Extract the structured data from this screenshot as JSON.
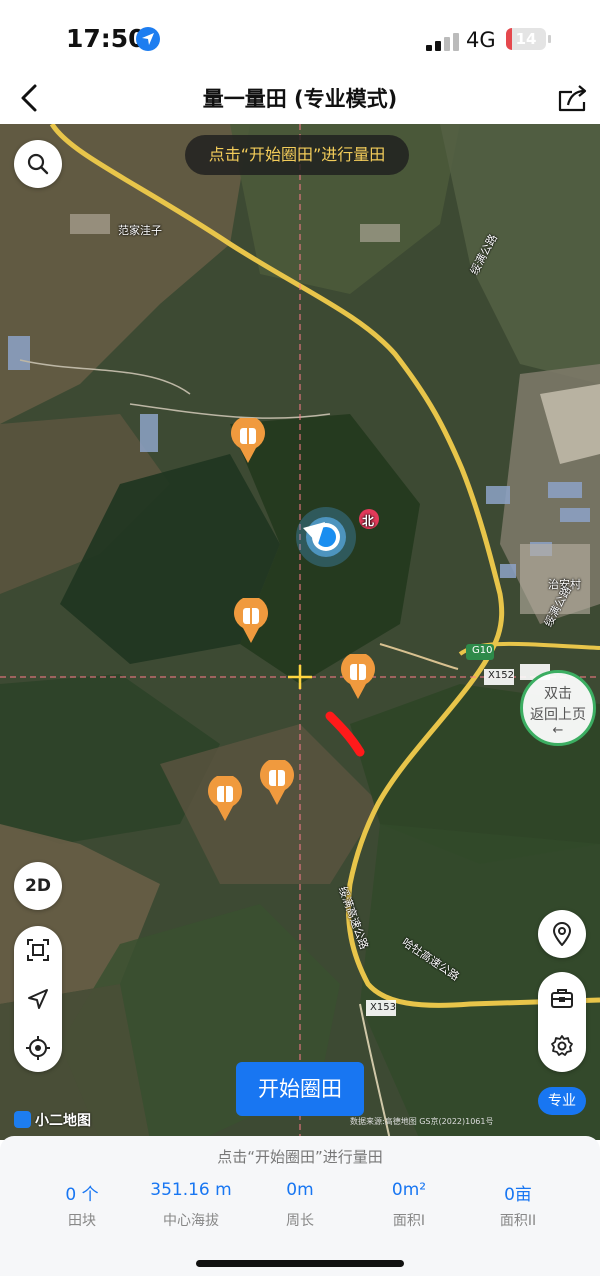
{
  "status_bar": {
    "time": "17:50",
    "network": "4G",
    "battery": "14",
    "battery_level": 0.14,
    "location_icon": "location-arrow-icon",
    "signal_icon": "cellular-signal-icon"
  },
  "nav": {
    "back_icon": "chevron-left-icon",
    "title": "量一量田 (专业模式)",
    "share_icon": "share-icon"
  },
  "map": {
    "hint": "点击“开始圈田”进行量田",
    "labels": {
      "village_fanjia": "范家洼子",
      "road_suiman_1": "绥满公路",
      "road_suiman_2": "绥满公路",
      "compass_north": "北",
      "village_zhian": "治安村",
      "expressway_g10": "G10",
      "road_x152": "X152",
      "road_x153": "X153",
      "expressway_suiman": "绥满高速公路",
      "expressway_hama": "哈牡高速公路"
    },
    "back_page": {
      "line1": "双击",
      "line2": "返回上页",
      "arrow": "←"
    },
    "start_button": "开始圈田",
    "logo": "小二地图",
    "copyright": "数据来源:高德地图 GS京(2022)1061号",
    "pro_badge": "专业",
    "mode_2d": "2D",
    "left_tools": [
      "capture-frame-icon",
      "navigation-arrow-icon",
      "locate-crosshair-icon"
    ],
    "right_tools": [
      "toolbox-icon",
      "settings-gear-icon"
    ],
    "search_icon": "search-icon",
    "location_pin_icon": "location-pin-icon",
    "field_pin_icon": "field-marker-icon",
    "colors": {
      "accent": "#1876f2",
      "road": "#e8c54a",
      "pin": "#f09a3e",
      "hint_text": "#f2cc5a",
      "back_page_border": "#3cae62",
      "drawn_stroke": "#ff1a1a"
    }
  },
  "panel": {
    "hint": "点击“开始圈田”进行量田",
    "stats": [
      {
        "value": "0 个",
        "label": "田块"
      },
      {
        "value": "351.16 m",
        "label": "中心海拔"
      },
      {
        "value": "0m",
        "label": "周长"
      },
      {
        "value": "0m²",
        "label": "面积I"
      },
      {
        "value": "0亩",
        "label": "面积II"
      }
    ]
  }
}
